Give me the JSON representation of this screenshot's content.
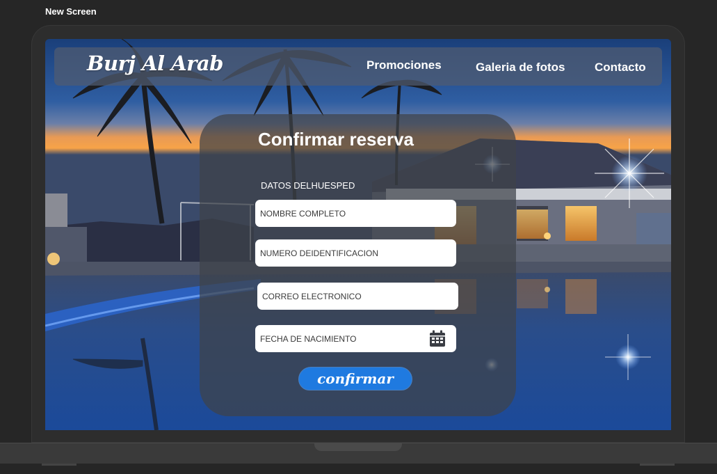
{
  "frame": {
    "label": "New Screen"
  },
  "navbar": {
    "brand": "Burj Al Arab",
    "links": [
      {
        "label": "Promociones"
      },
      {
        "label": "Galeria de fotos"
      },
      {
        "label": "Contacto"
      }
    ]
  },
  "form": {
    "title": "Confirmar reserva",
    "section_label": "DATOS DELHUESPED",
    "fields": [
      {
        "placeholder": "NOMBRE COMPLETO",
        "value": ""
      },
      {
        "placeholder": "NUMERO DEIDENTIFICACION",
        "value": ""
      },
      {
        "placeholder": "CORREO ELECTRONICO",
        "value": ""
      },
      {
        "placeholder": "FECHA DE NACIMIENTO",
        "value": "",
        "icon": "calendar-icon"
      }
    ],
    "submit_label": "confirmar"
  },
  "colors": {
    "accent": "#1f7ae0",
    "navbar_bg": "#505c70",
    "card_bg": "#3e424a",
    "page_bg": "#262626"
  }
}
